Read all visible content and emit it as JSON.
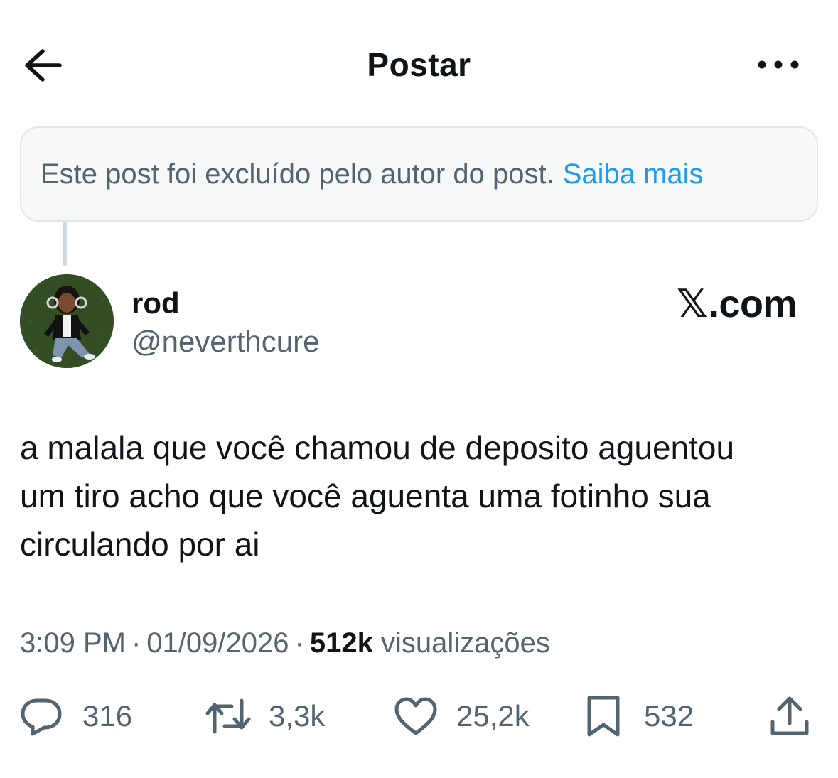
{
  "header": {
    "title": "Postar"
  },
  "deleted_notice": {
    "text": "Este post foi excluído pelo autor do post.",
    "link": "Saiba mais"
  },
  "author": {
    "name": "rod",
    "handle": "@neverthcure"
  },
  "brand": {
    "x_glyph": "𝕏",
    "suffix": ".com"
  },
  "post": {
    "lines": [
      "a malala que você chamou de deposito aguentou",
      "um tiro acho que você aguenta uma fotinho sua",
      "circulando por ai"
    ]
  },
  "meta": {
    "time": "3:09 PM",
    "date": "01/09/2026",
    "separator": "·",
    "views": "512k",
    "views_label": "visualizações"
  },
  "actions": {
    "replies": "316",
    "reposts": "3,3k",
    "likes": "25,2k",
    "bookmarks": "532"
  },
  "icons": {
    "back": "arrow-left-icon",
    "more": "more-horizontal-icon",
    "reply": "speech-bubble-icon",
    "repost": "repost-arrows-icon",
    "like": "heart-icon",
    "bookmark": "bookmark-icon",
    "share": "share-upload-icon"
  },
  "colors": {
    "text": "#0f1419",
    "secondary": "#536471",
    "link": "#1d9bf0",
    "notice_bg": "#f7f9f9",
    "border": "#e1e6ea"
  }
}
